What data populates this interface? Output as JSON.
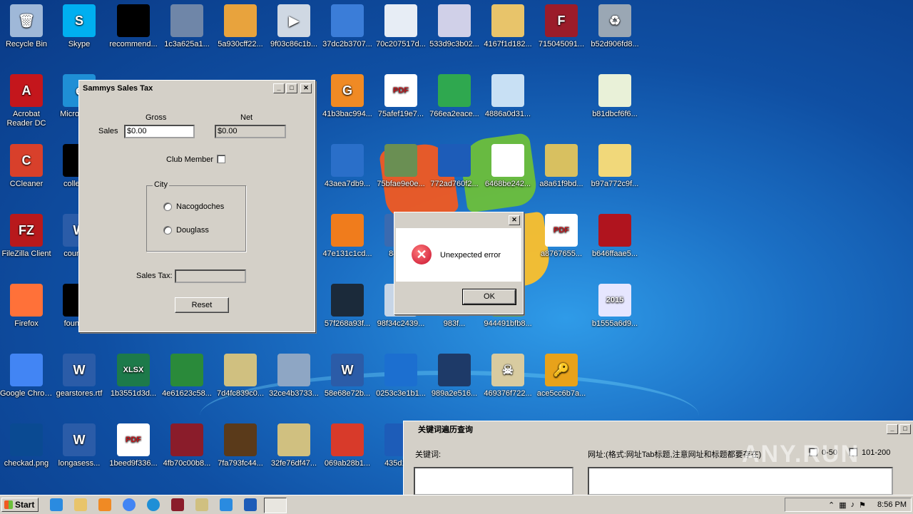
{
  "desktop": {
    "icons": [
      {
        "label": "Recycle Bin",
        "color": "#9fb8d8",
        "glyph": "🗑"
      },
      {
        "label": "Skype",
        "color": "#00aff0",
        "glyph": "S"
      },
      {
        "label": "recommend...",
        "color": "#000000",
        "glyph": ""
      },
      {
        "label": "1c3a625a1...",
        "color": "#6f86a8",
        "glyph": ""
      },
      {
        "label": "5a930cff22...",
        "color": "#e8a33d",
        "glyph": ""
      },
      {
        "label": "9f03c86c1b...",
        "color": "#cfd8e3",
        "glyph": "▶"
      },
      {
        "label": "37dc2b3707...",
        "color": "#3b7dd8",
        "glyph": ""
      },
      {
        "label": "70c207517d...",
        "color": "#e7edf5",
        "glyph": ""
      },
      {
        "label": "533d9c3b02...",
        "color": "#d0d0e8",
        "glyph": ""
      },
      {
        "label": "4167f1d182...",
        "color": "#e8c46a",
        "glyph": ""
      },
      {
        "label": "715045091...",
        "color": "#9b1c2a",
        "glyph": "F"
      },
      {
        "label": "b52d906fd8...",
        "color": "#9aa7b4",
        "glyph": "♻"
      },
      {
        "label": "Acrobat Reader DC",
        "color": "#c4161c",
        "glyph": "A"
      },
      {
        "label": "Microsoft...",
        "color": "#1f8fd6",
        "glyph": "e"
      },
      {
        "label": "41b3bac994...",
        "color": "#f08a24",
        "glyph": "G"
      },
      {
        "label": "75afef19e7...",
        "color": "#ffffff",
        "glyph": "PDF"
      },
      {
        "label": "766ea2eace...",
        "color": "#2fa84f",
        "glyph": ""
      },
      {
        "label": "4886a0d31...",
        "color": "#c8e0f4",
        "glyph": ""
      },
      {
        "label": "b81dbcf6f6...",
        "color": "#e9f1d8",
        "glyph": ""
      },
      {
        "label": "CCleaner",
        "color": "#d8402b",
        "glyph": "C"
      },
      {
        "label": "college...",
        "color": "#000000",
        "glyph": ""
      },
      {
        "label": "43aea7db9...",
        "color": "#2a6fc9",
        "glyph": ""
      },
      {
        "label": "75bfae9e0e...",
        "color": "#6a8f53",
        "glyph": ""
      },
      {
        "label": "772ad760f2...",
        "color": "#1d5cb8",
        "glyph": ""
      },
      {
        "label": "6468be242...",
        "color": "#ffffff",
        "glyph": ""
      },
      {
        "label": "a8a61f9bd...",
        "color": "#d8c060",
        "glyph": ""
      },
      {
        "label": "b97a772c9f...",
        "color": "#f1d87a",
        "glyph": ""
      },
      {
        "label": "FileZilla Client",
        "color": "#b8191c",
        "glyph": "FZ"
      },
      {
        "label": "council...",
        "color": "#2b5ca8",
        "glyph": "W"
      },
      {
        "label": "47e131c1cd...",
        "color": "#f07c1c",
        "glyph": ""
      },
      {
        "label": "84a9...",
        "color": "#3a6ab0",
        "glyph": ""
      },
      {
        "label": "a8767655...",
        "color": "#ffffff",
        "glyph": "PDF"
      },
      {
        "label": "b646ffaae5...",
        "color": "#b0141e",
        "glyph": ""
      },
      {
        "label": "Firefox",
        "color": "#ff7139",
        "glyph": ""
      },
      {
        "label": "founda...",
        "color": "#000000",
        "glyph": ""
      },
      {
        "label": "57f268a93f...",
        "color": "#1b2a3a",
        "glyph": ""
      },
      {
        "label": "98f34c2439...",
        "color": "#c7d5e6",
        "glyph": ""
      },
      {
        "label": "983f...",
        "color": "#4a7cc2",
        "glyph": ""
      },
      {
        "label": "944491bfb8...",
        "color": "#6aa24a",
        "glyph": ""
      },
      {
        "label": "b1555a6d9...",
        "color": "#e6e6ff",
        "glyph": "2015"
      },
      {
        "label": "Google Chrome",
        "color": "#4285f4",
        "glyph": ""
      },
      {
        "label": "gearstores.rtf",
        "color": "#2b5ca8",
        "glyph": "W"
      },
      {
        "label": "1b3551d3d...",
        "color": "#1d7a4a",
        "glyph": "XLSX"
      },
      {
        "label": "4e61623c58...",
        "color": "#2a8a3a",
        "glyph": ""
      },
      {
        "label": "7d4fc839c0...",
        "color": "#d0c080",
        "glyph": ""
      },
      {
        "label": "32ce4b3733...",
        "color": "#8ea6c4",
        "glyph": ""
      },
      {
        "label": "58e68e72b...",
        "color": "#2b5ca8",
        "glyph": "W"
      },
      {
        "label": "0253c3e1b1...",
        "color": "#1c6fd0",
        "glyph": ""
      },
      {
        "label": "989a2e516...",
        "color": "#1e3a68",
        "glyph": ""
      },
      {
        "label": "469376f722...",
        "color": "#d8cba0",
        "glyph": "☠"
      },
      {
        "label": "ace5cc6b7a...",
        "color": "#e8a21a",
        "glyph": "🔑"
      },
      {
        "label": "checkad.png",
        "color": "#0a4a92",
        "glyph": ""
      },
      {
        "label": "longasess...",
        "color": "#2b5ca8",
        "glyph": "W"
      },
      {
        "label": "1beed9f336...",
        "color": "#ffffff",
        "glyph": "PDF"
      },
      {
        "label": "4fb70c00b8...",
        "color": "#8a1c2a",
        "glyph": ""
      },
      {
        "label": "7fa793fc44...",
        "color": "#5a3a1a",
        "glyph": ""
      },
      {
        "label": "32fe76df47...",
        "color": "#d0c080",
        "glyph": ""
      },
      {
        "label": "069ab28b1...",
        "color": "#d83a2a",
        "glyph": ""
      },
      {
        "label": "435d1a...",
        "color": "#1d5cb8",
        "glyph": ""
      }
    ]
  },
  "sales_window": {
    "title": "Sammys Sales Tax",
    "gross_label": "Gross",
    "net_label": "Net",
    "sales_label": "Sales",
    "gross_value": "$0.00",
    "net_value": "$0.00",
    "club_member_label": "Club Member",
    "city_group_label": "City",
    "city_options": [
      "Nacogdoches",
      "Douglass"
    ],
    "sales_tax_label": "Sales Tax:",
    "sales_tax_value": "",
    "reset_label": "Reset"
  },
  "error_dialog": {
    "title": "",
    "message": "Unexpected error",
    "ok_label": "OK"
  },
  "keyword_window": {
    "title": "关键词遍历查询",
    "keyword_label": "关键词:",
    "url_label": "网址:(格式:网址Tab标题,注意网址和标题都要存在)",
    "option1_label": "0-50",
    "option2_label": "101-200"
  },
  "taskbar": {
    "start_label": "Start",
    "time": "8:56 PM"
  },
  "watermark": "ANY.RUN"
}
